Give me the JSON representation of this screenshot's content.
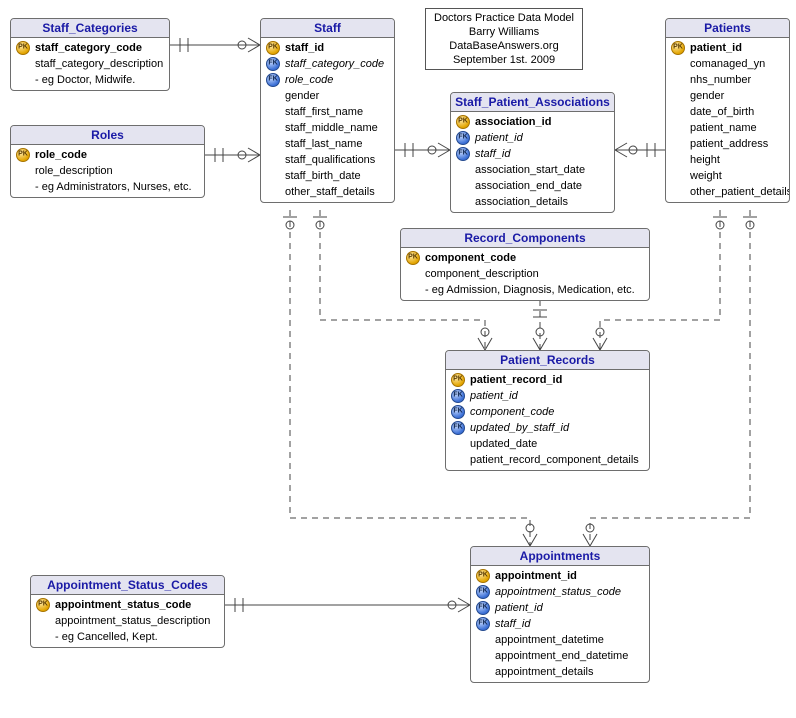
{
  "meta": {
    "title": "Doctors Practice Data Model",
    "author": "Barry Williams",
    "source": "DataBaseAnswers.org",
    "date": "September 1st. 2009"
  },
  "entities": {
    "staff_categories": {
      "title": "Staff_Categories",
      "attrs": [
        {
          "key": "pk",
          "name": "staff_category_code",
          "bold": true
        },
        {
          "key": "",
          "name": "staff_category_description"
        },
        {
          "key": "",
          "name": "- eg Doctor, Midwife."
        }
      ]
    },
    "roles": {
      "title": "Roles",
      "attrs": [
        {
          "key": "pk",
          "name": "role_code",
          "bold": true
        },
        {
          "key": "",
          "name": "role_description"
        },
        {
          "key": "",
          "name": "- eg Administrators, Nurses, etc."
        }
      ]
    },
    "staff": {
      "title": "Staff",
      "attrs": [
        {
          "key": "pk",
          "name": "staff_id",
          "bold": true
        },
        {
          "key": "fk",
          "name": "staff_category_code",
          "italic": true
        },
        {
          "key": "fk",
          "name": "role_code",
          "italic": true
        },
        {
          "key": "",
          "name": "gender"
        },
        {
          "key": "",
          "name": "staff_first_name"
        },
        {
          "key": "",
          "name": "staff_middle_name"
        },
        {
          "key": "",
          "name": "staff_last_name"
        },
        {
          "key": "",
          "name": "staff_qualifications"
        },
        {
          "key": "",
          "name": "staff_birth_date"
        },
        {
          "key": "",
          "name": "other_staff_details"
        }
      ]
    },
    "staff_patient_assoc": {
      "title": "Staff_Patient_Associations",
      "attrs": [
        {
          "key": "pk",
          "name": "association_id",
          "bold": true
        },
        {
          "key": "fk",
          "name": "patient_id",
          "italic": true
        },
        {
          "key": "fk",
          "name": "staff_id",
          "italic": true
        },
        {
          "key": "",
          "name": "association_start_date"
        },
        {
          "key": "",
          "name": "association_end_date"
        },
        {
          "key": "",
          "name": "association_details"
        }
      ]
    },
    "patients": {
      "title": "Patients",
      "attrs": [
        {
          "key": "pk",
          "name": "patient_id",
          "bold": true
        },
        {
          "key": "",
          "name": "comanaged_yn"
        },
        {
          "key": "",
          "name": "nhs_number"
        },
        {
          "key": "",
          "name": "gender"
        },
        {
          "key": "",
          "name": "date_of_birth"
        },
        {
          "key": "",
          "name": "patient_name"
        },
        {
          "key": "",
          "name": "patient_address"
        },
        {
          "key": "",
          "name": "height"
        },
        {
          "key": "",
          "name": "weight"
        },
        {
          "key": "",
          "name": "other_patient_details"
        }
      ]
    },
    "record_components": {
      "title": "Record_Components",
      "attrs": [
        {
          "key": "pk",
          "name": "component_code",
          "bold": true
        },
        {
          "key": "",
          "name": "component_description"
        },
        {
          "key": "",
          "name": "- eg Admission, Diagnosis, Medication, etc."
        }
      ]
    },
    "patient_records": {
      "title": "Patient_Records",
      "attrs": [
        {
          "key": "pk",
          "name": "patient_record_id",
          "bold": true
        },
        {
          "key": "fk",
          "name": "patient_id",
          "italic": true
        },
        {
          "key": "fk",
          "name": "component_code",
          "italic": true
        },
        {
          "key": "fk",
          "name": "updated_by_staff_id",
          "italic": true
        },
        {
          "key": "",
          "name": "updated_date"
        },
        {
          "key": "",
          "name": "patient_record_component_details"
        }
      ]
    },
    "appointments": {
      "title": "Appointments",
      "attrs": [
        {
          "key": "pk",
          "name": "appointment_id",
          "bold": true
        },
        {
          "key": "fk",
          "name": "appointment_status_code",
          "italic": true
        },
        {
          "key": "fk",
          "name": "patient_id",
          "italic": true
        },
        {
          "key": "fk",
          "name": "staff_id",
          "italic": true
        },
        {
          "key": "",
          "name": "appointment_datetime"
        },
        {
          "key": "",
          "name": "appointment_end_datetime"
        },
        {
          "key": "",
          "name": "appointment_details"
        }
      ]
    },
    "appointment_status_codes": {
      "title": "Appointment_Status_Codes",
      "attrs": [
        {
          "key": "pk",
          "name": "appointment_status_code",
          "bold": true
        },
        {
          "key": "",
          "name": "appointment_status_description"
        },
        {
          "key": "",
          "name": "- eg Cancelled, Kept."
        }
      ]
    }
  },
  "relationships": [
    {
      "from": "staff_categories",
      "to": "staff",
      "type": "one-to-many",
      "style": "solid"
    },
    {
      "from": "roles",
      "to": "staff",
      "type": "one-to-many",
      "style": "solid"
    },
    {
      "from": "staff",
      "to": "staff_patient_assoc",
      "type": "one-to-many",
      "style": "solid"
    },
    {
      "from": "patients",
      "to": "staff_patient_assoc",
      "type": "one-to-many",
      "style": "solid"
    },
    {
      "from": "staff",
      "to": "patient_records",
      "type": "one-to-many",
      "style": "dashed"
    },
    {
      "from": "patients",
      "to": "patient_records",
      "type": "one-to-many",
      "style": "dashed"
    },
    {
      "from": "record_components",
      "to": "patient_records",
      "type": "one-to-many",
      "style": "dashed"
    },
    {
      "from": "staff",
      "to": "appointments",
      "type": "one-to-many",
      "style": "dashed"
    },
    {
      "from": "patients",
      "to": "appointments",
      "type": "one-to-many",
      "style": "dashed"
    },
    {
      "from": "appointment_status_codes",
      "to": "appointments",
      "type": "one-to-many",
      "style": "solid"
    }
  ]
}
